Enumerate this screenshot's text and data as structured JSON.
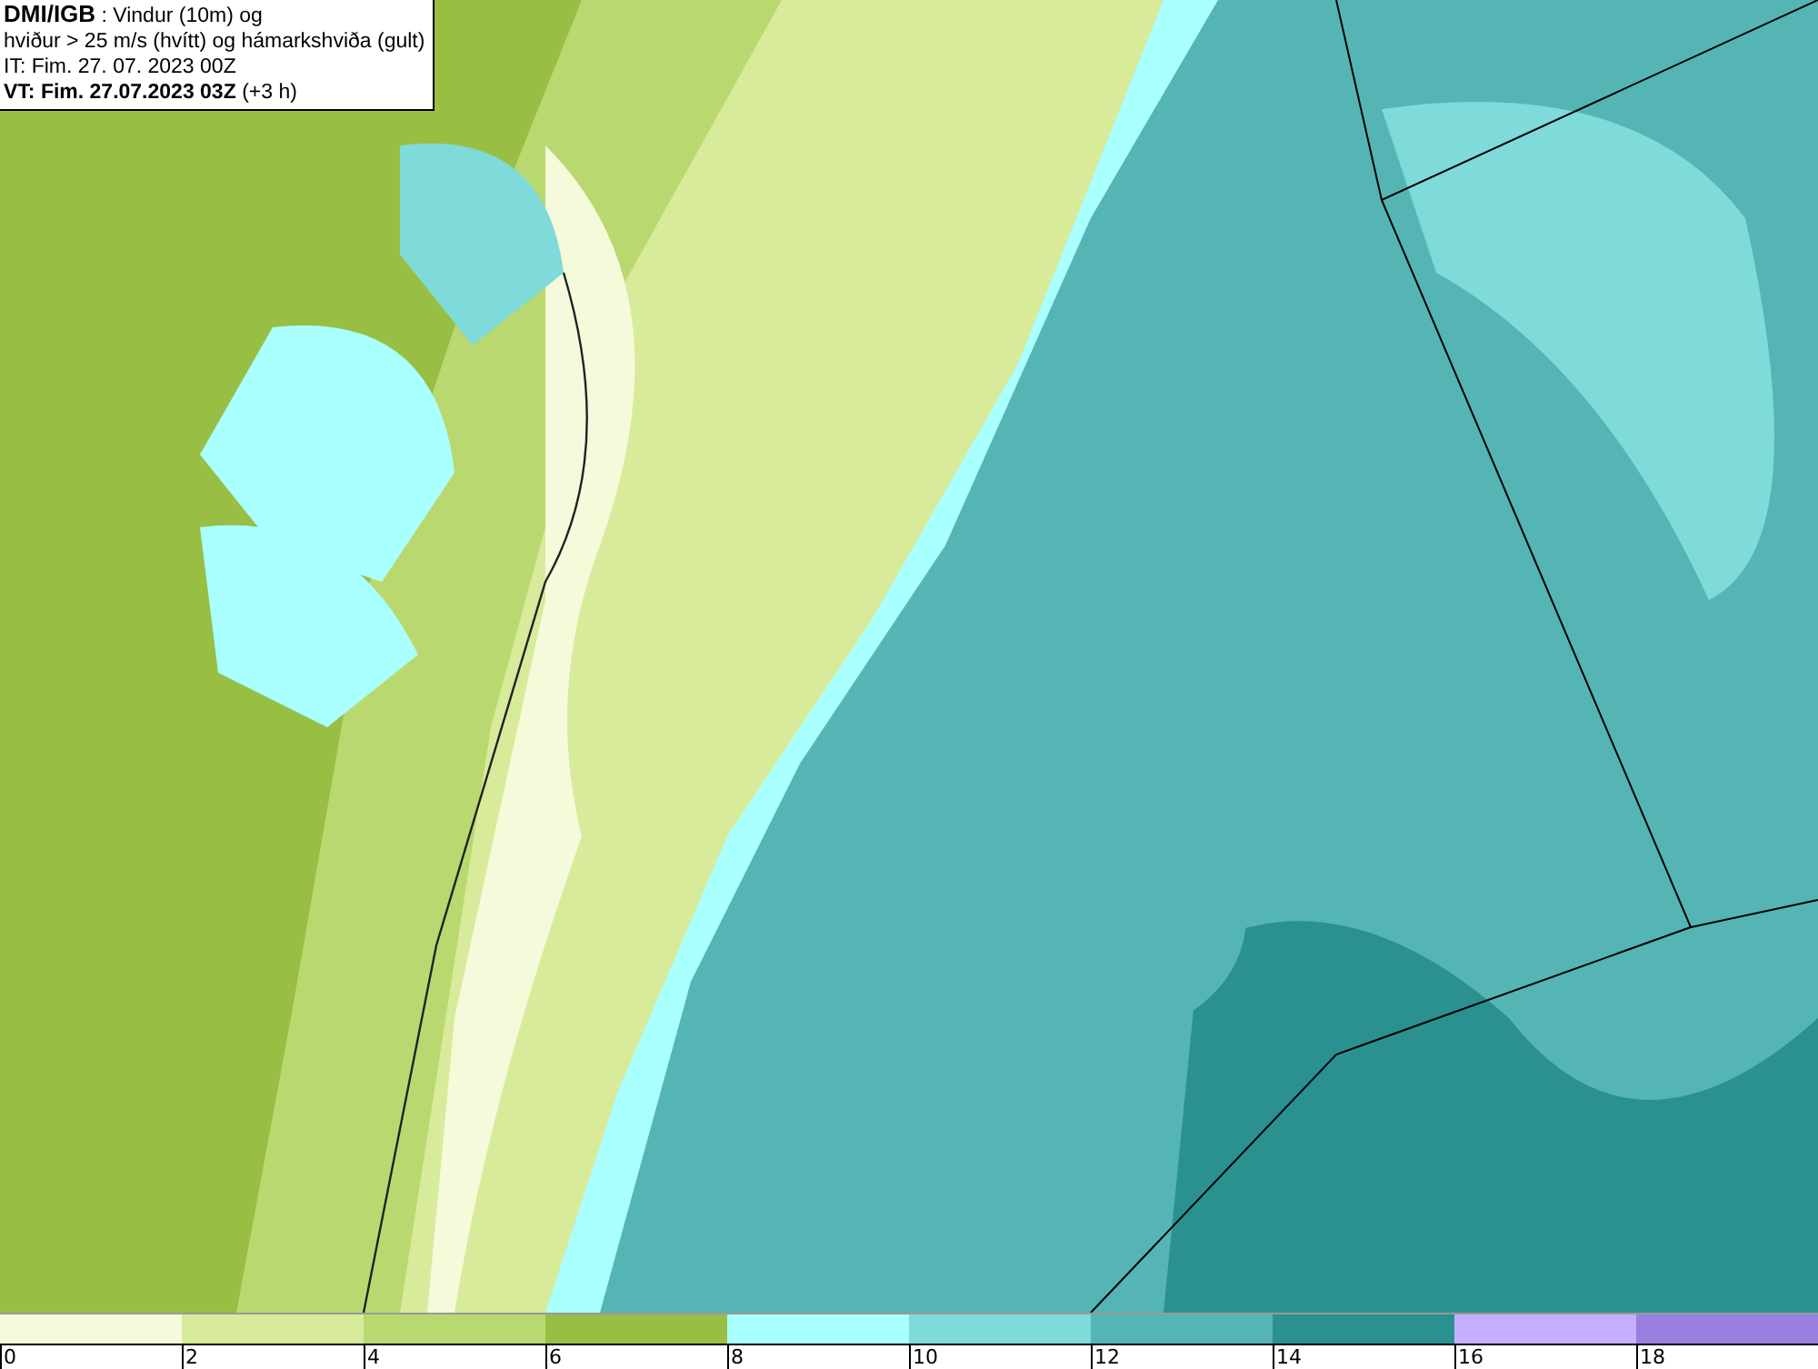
{
  "header": {
    "source": "DMI/IGB",
    "description_1": ": Vindur (10m) og",
    "description_2": "hviður > 25 m/s (hvítt) og hámarkshviða (gult)",
    "issue_time": "IT: Fim. 27. 07. 2023 00Z",
    "valid_time": "VT: Fim. 27.07.2023 03Z",
    "lead": "(+3 h)"
  },
  "legend": {
    "bins": [
      {
        "color": "#f5fadb"
      },
      {
        "color": "#d8eb9a"
      },
      {
        "color": "#b9d970"
      },
      {
        "color": "#98bf44"
      },
      {
        "color": "#aaffff"
      },
      {
        "color": "#7fdada"
      },
      {
        "color": "#55b4b4"
      },
      {
        "color": "#2a9090"
      },
      {
        "color": "#c4b0ff"
      },
      {
        "color": "#9a7fe0"
      }
    ],
    "ticks": [
      "0",
      "2",
      "4",
      "6",
      "8",
      "10",
      "12",
      "14",
      "16",
      "18"
    ]
  }
}
